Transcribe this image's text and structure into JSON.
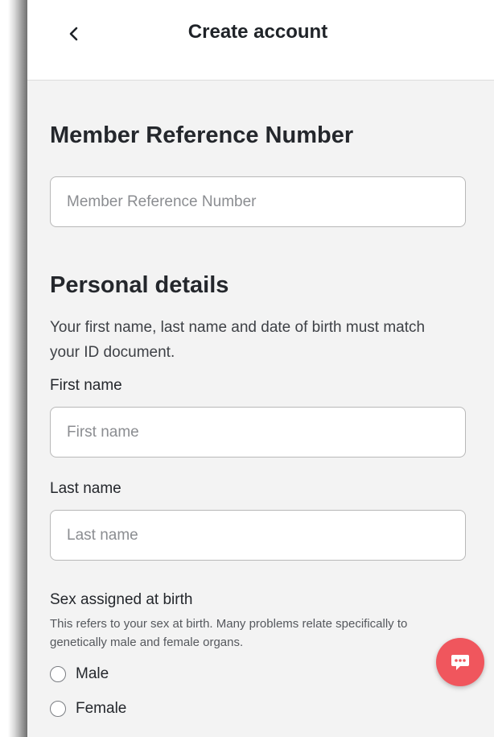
{
  "header": {
    "title": "Create account",
    "back_icon": "chevron-left-icon"
  },
  "member": {
    "heading": "Member Reference Number",
    "input_placeholder": "Member Reference Number",
    "input_value": ""
  },
  "personal": {
    "heading": "Personal details",
    "description": "Your first name, last name and date of birth must match your ID document.",
    "first_name_label": "First name",
    "first_name_placeholder": "First name",
    "last_name_label": "Last name",
    "last_name_placeholder": "Last name"
  },
  "sex": {
    "label": "Sex assigned at birth",
    "helper": "This refers to your sex at birth. Many problems relate specifically to genetically male and female organs.",
    "options": [
      {
        "label": "Male",
        "selected": false
      },
      {
        "label": "Female",
        "selected": false
      }
    ]
  },
  "chat": {
    "icon": "chat-bubble-icon",
    "color": "#f0565d"
  }
}
